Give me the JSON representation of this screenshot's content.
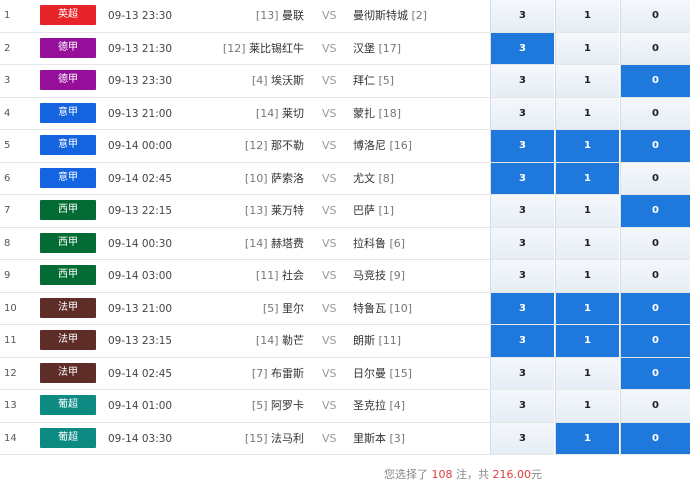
{
  "matches": [
    {
      "no": "1",
      "league": "英超",
      "color": "#e8242b",
      "time": "09-13 23:30",
      "home_rank": "[13]",
      "home": "曼联",
      "away": "曼彻斯特城",
      "away_rank": "[2]",
      "o3": "3",
      "o1": "1",
      "o0": "0",
      "sel": [
        false,
        false,
        false
      ]
    },
    {
      "no": "2",
      "league": "德甲",
      "color": "#950f9b",
      "time": "09-13 21:30",
      "home_rank": "[12]",
      "home": "莱比锡红牛",
      "away": "汉堡",
      "away_rank": "[17]",
      "o3": "3",
      "o1": "1",
      "o0": "0",
      "sel": [
        true,
        false,
        false
      ]
    },
    {
      "no": "3",
      "league": "德甲",
      "color": "#950f9b",
      "time": "09-13 23:30",
      "home_rank": "[4]",
      "home": "埃沃斯",
      "away": "拜仁",
      "away_rank": "[5]",
      "o3": "3",
      "o1": "1",
      "o0": "0",
      "sel": [
        false,
        false,
        true
      ]
    },
    {
      "no": "4",
      "league": "意甲",
      "color": "#1463e0",
      "time": "09-13 21:00",
      "home_rank": "[14]",
      "home": "莱切",
      "away": "蒙扎",
      "away_rank": "[18]",
      "o3": "3",
      "o1": "1",
      "o0": "0",
      "sel": [
        false,
        false,
        false
      ]
    },
    {
      "no": "5",
      "league": "意甲",
      "color": "#1463e0",
      "time": "09-14 00:00",
      "home_rank": "[12]",
      "home": "那不勒",
      "away": "博洛尼",
      "away_rank": "[16]",
      "o3": "3",
      "o1": "1",
      "o0": "0",
      "sel": [
        true,
        true,
        true
      ]
    },
    {
      "no": "6",
      "league": "意甲",
      "color": "#1463e0",
      "time": "09-14 02:45",
      "home_rank": "[10]",
      "home": "萨索洛",
      "away": "尤文",
      "away_rank": "[8]",
      "o3": "3",
      "o1": "1",
      "o0": "0",
      "sel": [
        true,
        true,
        false
      ]
    },
    {
      "no": "7",
      "league": "西甲",
      "color": "#036c34",
      "time": "09-13 22:15",
      "home_rank": "[13]",
      "home": "莱万特",
      "away": "巴萨",
      "away_rank": "[1]",
      "o3": "3",
      "o1": "1",
      "o0": "0",
      "sel": [
        false,
        false,
        true
      ]
    },
    {
      "no": "8",
      "league": "西甲",
      "color": "#036c34",
      "time": "09-14 00:30",
      "home_rank": "[14]",
      "home": "赫塔费",
      "away": "拉科鲁",
      "away_rank": "[6]",
      "o3": "3",
      "o1": "1",
      "o0": "0",
      "sel": [
        false,
        false,
        false
      ]
    },
    {
      "no": "9",
      "league": "西甲",
      "color": "#036c34",
      "time": "09-14 03:00",
      "home_rank": "[11]",
      "home": "社会",
      "away": "马竞技",
      "away_rank": "[9]",
      "o3": "3",
      "o1": "1",
      "o0": "0",
      "sel": [
        false,
        false,
        false
      ]
    },
    {
      "no": "10",
      "league": "法甲",
      "color": "#5e2d28",
      "time": "09-13 21:00",
      "home_rank": "[5]",
      "home": "里尔",
      "away": "特鲁瓦",
      "away_rank": "[10]",
      "o3": "3",
      "o1": "1",
      "o0": "0",
      "sel": [
        true,
        true,
        true
      ]
    },
    {
      "no": "11",
      "league": "法甲",
      "color": "#5e2d28",
      "time": "09-13 23:15",
      "home_rank": "[14]",
      "home": "勒芒",
      "away": "朗斯",
      "away_rank": "[11]",
      "o3": "3",
      "o1": "1",
      "o0": "0",
      "sel": [
        true,
        true,
        true
      ]
    },
    {
      "no": "12",
      "league": "法甲",
      "color": "#5e2d28",
      "time": "09-14 02:45",
      "home_rank": "[7]",
      "home": "布雷斯",
      "away": "日尔曼",
      "away_rank": "[15]",
      "o3": "3",
      "o1": "1",
      "o0": "0",
      "sel": [
        false,
        false,
        true
      ]
    },
    {
      "no": "13",
      "league": "葡超",
      "color": "#0d8b83",
      "time": "09-14 01:00",
      "home_rank": "[5]",
      "home": "阿罗卡",
      "away": "圣克拉",
      "away_rank": "[4]",
      "o3": "3",
      "o1": "1",
      "o0": "0",
      "sel": [
        false,
        false,
        false
      ]
    },
    {
      "no": "14",
      "league": "葡超",
      "color": "#0d8b83",
      "time": "09-14 03:30",
      "home_rank": "[15]",
      "home": "法马利",
      "away": "里斯本",
      "away_rank": "[3]",
      "o3": "3",
      "o1": "1",
      "o0": "0",
      "sel": [
        false,
        true,
        true
      ]
    }
  ],
  "vs_label": "VS",
  "summary": {
    "prefix": "您选择了 ",
    "count": "108",
    "mid": " 注，共 ",
    "amount": "216.00",
    "suffix": "元"
  },
  "colors": {
    "selected": "#1f79dd"
  }
}
